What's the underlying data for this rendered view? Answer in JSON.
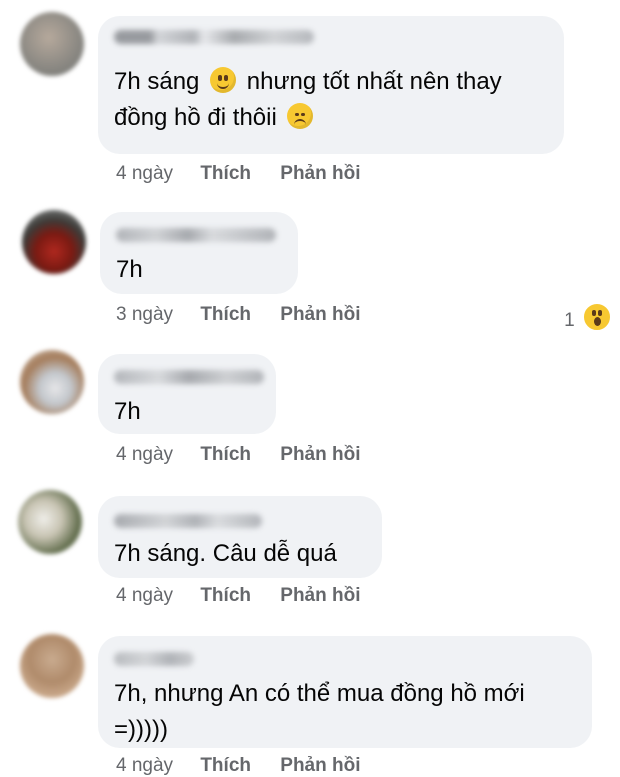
{
  "comments": [
    {
      "text_before": "7h sáng",
      "emoji1": "slight-smile-emoji",
      "text_middle": "nhưng tốt nhất nên thay",
      "text_line2": "đồng hồ đi thôii",
      "emoji2": "disappointed-emoji",
      "time": "4 ngày",
      "like": "Thích",
      "reply": "Phản hồi"
    },
    {
      "text": "7h",
      "time": "3 ngày",
      "like": "Thích",
      "reply": "Phản hồi",
      "reaction_count": "1",
      "reaction_icon": "wow-emoji"
    },
    {
      "text": "7h",
      "time": "4 ngày",
      "like": "Thích",
      "reply": "Phản hồi"
    },
    {
      "text": "7h sáng. Câu dễ quá",
      "time": "4 ngày",
      "like": "Thích",
      "reply": "Phản hồi"
    },
    {
      "text_line1": "7h, nhưng An có thể mua đồng hồ mới",
      "text_line2": "=)))))",
      "time": "4 ngày",
      "like": "Thích",
      "reply": "Phản hồi"
    }
  ],
  "colors": {
    "bubble": "#f0f2f5",
    "text": "#050505",
    "meta": "#65676b",
    "emoji": "#f7c831"
  }
}
